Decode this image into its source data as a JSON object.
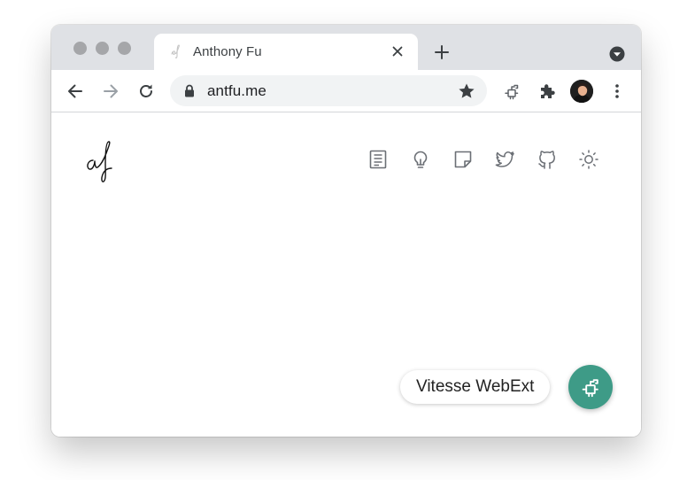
{
  "browser": {
    "tab": {
      "title": "Anthony Fu",
      "favicon": "af-signature-favicon",
      "close_icon": "close-icon"
    },
    "new_tab_icon": "plus-icon",
    "tab_search_icon": "chevron-down-circle-icon",
    "toolbar": {
      "back_icon": "arrow-left-icon",
      "forward_icon": "arrow-right-icon",
      "reload_icon": "reload-icon",
      "lock_icon": "lock-icon",
      "url": "antfu.me",
      "bookmark_icon": "star-icon",
      "extension_icon": "vitesse-webext-icon",
      "extensions_icon": "puzzle-icon",
      "profile": "avatar",
      "menu_icon": "kebab-menu-icon"
    }
  },
  "page": {
    "logo": "af-signature-logo",
    "nav": [
      {
        "icon": "article-icon"
      },
      {
        "icon": "lightbulb-icon"
      },
      {
        "icon": "note-icon"
      },
      {
        "icon": "twitter-icon"
      },
      {
        "icon": "github-icon"
      },
      {
        "icon": "sun-icon"
      }
    ],
    "extension_popup": {
      "label": "Vitesse WebExt",
      "button_icon": "vitesse-webext-icon",
      "accent_color": "#3e9b87"
    }
  }
}
